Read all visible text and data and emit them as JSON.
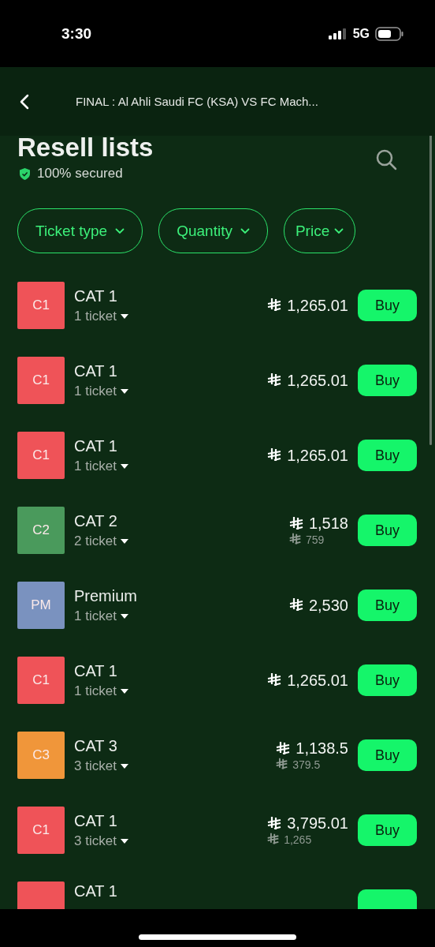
{
  "status_bar": {
    "time": "3:30",
    "network": "5G"
  },
  "header": {
    "title": "FINAL : Al Ahli Saudi FC (KSA) VS FC Mach..."
  },
  "page": {
    "title": "Resell lists",
    "secured": "100% secured"
  },
  "filters": [
    {
      "label": "Ticket type"
    },
    {
      "label": "Quantity"
    },
    {
      "label": "Price"
    }
  ],
  "listings": [
    {
      "kind": "full",
      "code": "C1",
      "color": "#ef5358",
      "name": "CAT 1",
      "quantity": "1 ticket",
      "price": "1,265.01",
      "button": "Buy"
    },
    {
      "kind": "full",
      "code": "C1",
      "color": "#ef5358",
      "name": "CAT 1",
      "quantity": "1 ticket",
      "price": "1,265.01",
      "button": "Buy"
    },
    {
      "kind": "full",
      "code": "C1",
      "color": "#ef5358",
      "name": "CAT 1",
      "quantity": "1 ticket",
      "price": "1,265.01",
      "button": "Buy"
    },
    {
      "kind": "full",
      "code": "C2",
      "color": "#4a9a5c",
      "name": "CAT 2",
      "quantity": "2 ticket",
      "price": "1,518",
      "unit_price": "759",
      "button": "Buy"
    },
    {
      "kind": "full",
      "code": "PM",
      "color": "#7a92bf",
      "name": "Premium",
      "quantity": "1 ticket",
      "price": "2,530",
      "button": "Buy"
    },
    {
      "kind": "full",
      "code": "C1",
      "color": "#ef5358",
      "name": "CAT 1",
      "quantity": "1 ticket",
      "price": "1,265.01",
      "button": "Buy"
    },
    {
      "kind": "full",
      "code": "C3",
      "color": "#f0963a",
      "name": "CAT 3",
      "quantity": "3 ticket",
      "price": "1,138.5",
      "unit_price": "379.5",
      "button": "Buy"
    },
    {
      "kind": "full",
      "code": "C1",
      "color": "#ef5358",
      "name": "CAT 1",
      "quantity": "3 ticket",
      "price": "3,795.01",
      "unit_price": "1,265",
      "button": "Buy"
    },
    {
      "kind": "partial",
      "color": "#ef5358",
      "name": "CAT 1"
    }
  ]
}
